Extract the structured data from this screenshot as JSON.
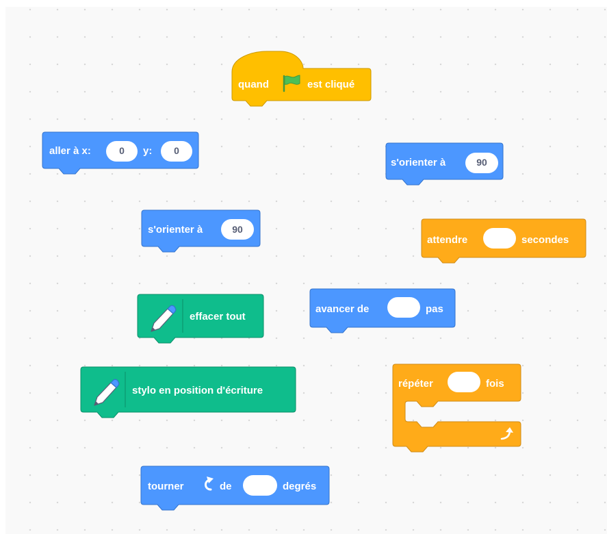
{
  "colors": {
    "motion": "#4c97ff",
    "motion_dark": "#3373cc",
    "events": "#ffbf00",
    "events_dark": "#cc9900",
    "control": "#ffab19",
    "control_dark": "#cf8b17",
    "pen": "#0fbd8c",
    "pen_dark": "#0b8e69",
    "workspace": "#f9f9f9",
    "flag": "#4cbf56"
  },
  "blocks": {
    "when_flag_clicked": {
      "label_before": "quand",
      "icon": "green-flag-icon",
      "label_after": "est cliqué"
    },
    "go_to_xy": {
      "label": "aller à x:",
      "x_value": "0",
      "y_label": "y:",
      "y_value": "0"
    },
    "point_direction_1": {
      "label": "s'orienter à",
      "value": "90"
    },
    "point_direction_2": {
      "label": "s'orienter à",
      "value": "90"
    },
    "wait_seconds": {
      "label_before": "attendre",
      "value": "",
      "label_after": "secondes"
    },
    "pen_clear": {
      "icon": "pen-icon",
      "label": "effacer tout"
    },
    "move_steps": {
      "label_before": "avancer de",
      "value": "",
      "label_after": "pas"
    },
    "pen_down": {
      "icon": "pen-icon",
      "label": "stylo en position d'écriture"
    },
    "repeat": {
      "label_before": "répéter",
      "value": "",
      "label_after": "fois",
      "icon": "loop-arrow-icon"
    },
    "turn_right": {
      "label_before": "tourner",
      "icon": "rotate-right-icon",
      "label_mid": "de",
      "value": "",
      "label_after": "degrés"
    }
  }
}
